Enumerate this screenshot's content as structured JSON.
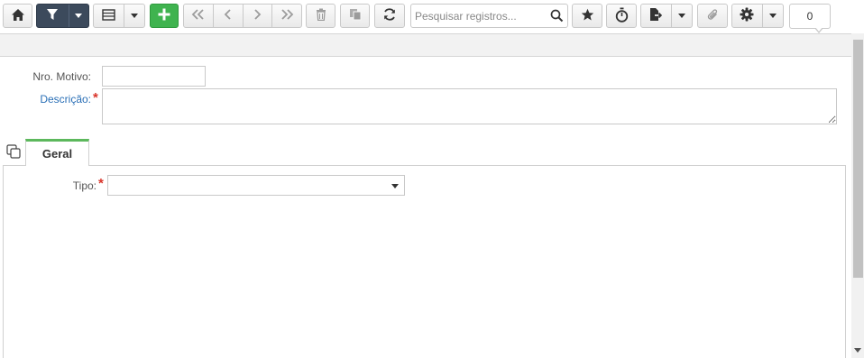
{
  "toolbar": {
    "buttons": [
      {
        "name": "home-button",
        "icon": "home-icon"
      },
      {
        "name": "filter-button",
        "icon": "filter-icon"
      },
      {
        "name": "view-list-button",
        "icon": "list-icon"
      },
      {
        "name": "add-button",
        "icon": "plus-icon"
      },
      {
        "name": "first-record-button",
        "icon": "double-chevron-left-icon"
      },
      {
        "name": "previous-record-button",
        "icon": "chevron-left-icon"
      },
      {
        "name": "next-record-button",
        "icon": "chevron-right-icon"
      },
      {
        "name": "last-record-button",
        "icon": "double-chevron-right-icon"
      },
      {
        "name": "delete-button",
        "icon": "trash-icon"
      },
      {
        "name": "copy-button",
        "icon": "copy-icon"
      },
      {
        "name": "refresh-button",
        "icon": "refresh-icon"
      },
      {
        "name": "favorite-button",
        "icon": "star-icon"
      },
      {
        "name": "timer-button",
        "icon": "stopwatch-icon"
      },
      {
        "name": "export-button",
        "icon": "export-file-icon"
      },
      {
        "name": "attachment-button",
        "icon": "paperclip-icon"
      },
      {
        "name": "settings-button",
        "icon": "gear-icon"
      }
    ],
    "search": {
      "placeholder": "Pesquisar registros...",
      "value": ""
    },
    "record_count": "0"
  },
  "form": {
    "nro_motivo": {
      "label": "Nro. Motivo:",
      "value": ""
    },
    "descricao": {
      "label": "Descrição:",
      "required_mark": "*",
      "value": ""
    }
  },
  "tabs": [
    {
      "label": "Geral",
      "active": true
    }
  ],
  "geral": {
    "tipo": {
      "label": "Tipo:",
      "required_mark": "*",
      "selected": ""
    }
  },
  "colors": {
    "accent_dark": "#3c4a5c",
    "add_green": "#3fb34f",
    "required_label": "#2a6fb6",
    "required_star": "#d9352b",
    "active_tab": "#5cb85c"
  }
}
